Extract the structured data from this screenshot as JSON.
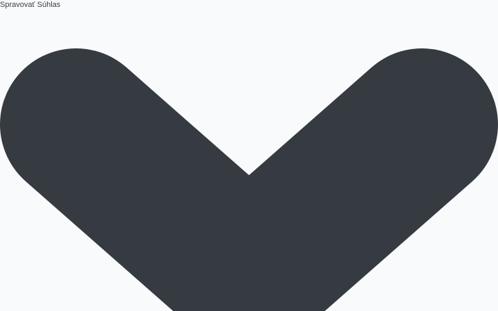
{
  "consent": {
    "title": "Spravovať Súhlas"
  },
  "toggle": {
    "icon": "chevron-down-icon",
    "color": "#363a41"
  },
  "colors": {
    "background": "#f8fafb",
    "text": "#3a3f45"
  }
}
